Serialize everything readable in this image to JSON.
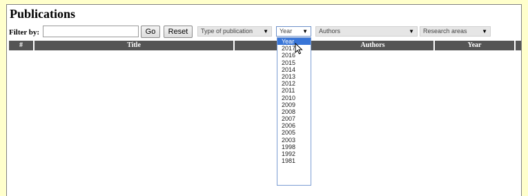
{
  "header": {
    "title": "Publications"
  },
  "filter": {
    "label": "Filter by:",
    "input_value": "",
    "go_label": "Go",
    "reset_label": "Reset"
  },
  "selects": {
    "type": "Type of publication",
    "year": "Year",
    "authors": "Authors",
    "areas": "Research areas"
  },
  "table": {
    "columns": [
      "#",
      "Title",
      "Authors",
      "Year"
    ]
  },
  "year_dropdown": {
    "options": [
      "Year",
      "2017",
      "2016",
      "2015",
      "2014",
      "2013",
      "2012",
      "2011",
      "2010",
      "2009",
      "2008",
      "2007",
      "2006",
      "2005",
      "2003",
      "1998",
      "1992",
      "1981"
    ],
    "selected": "Year"
  },
  "colors": {
    "page_bg": "#ffffcc",
    "header_bg": "#555555",
    "highlight": "#3875d7"
  }
}
